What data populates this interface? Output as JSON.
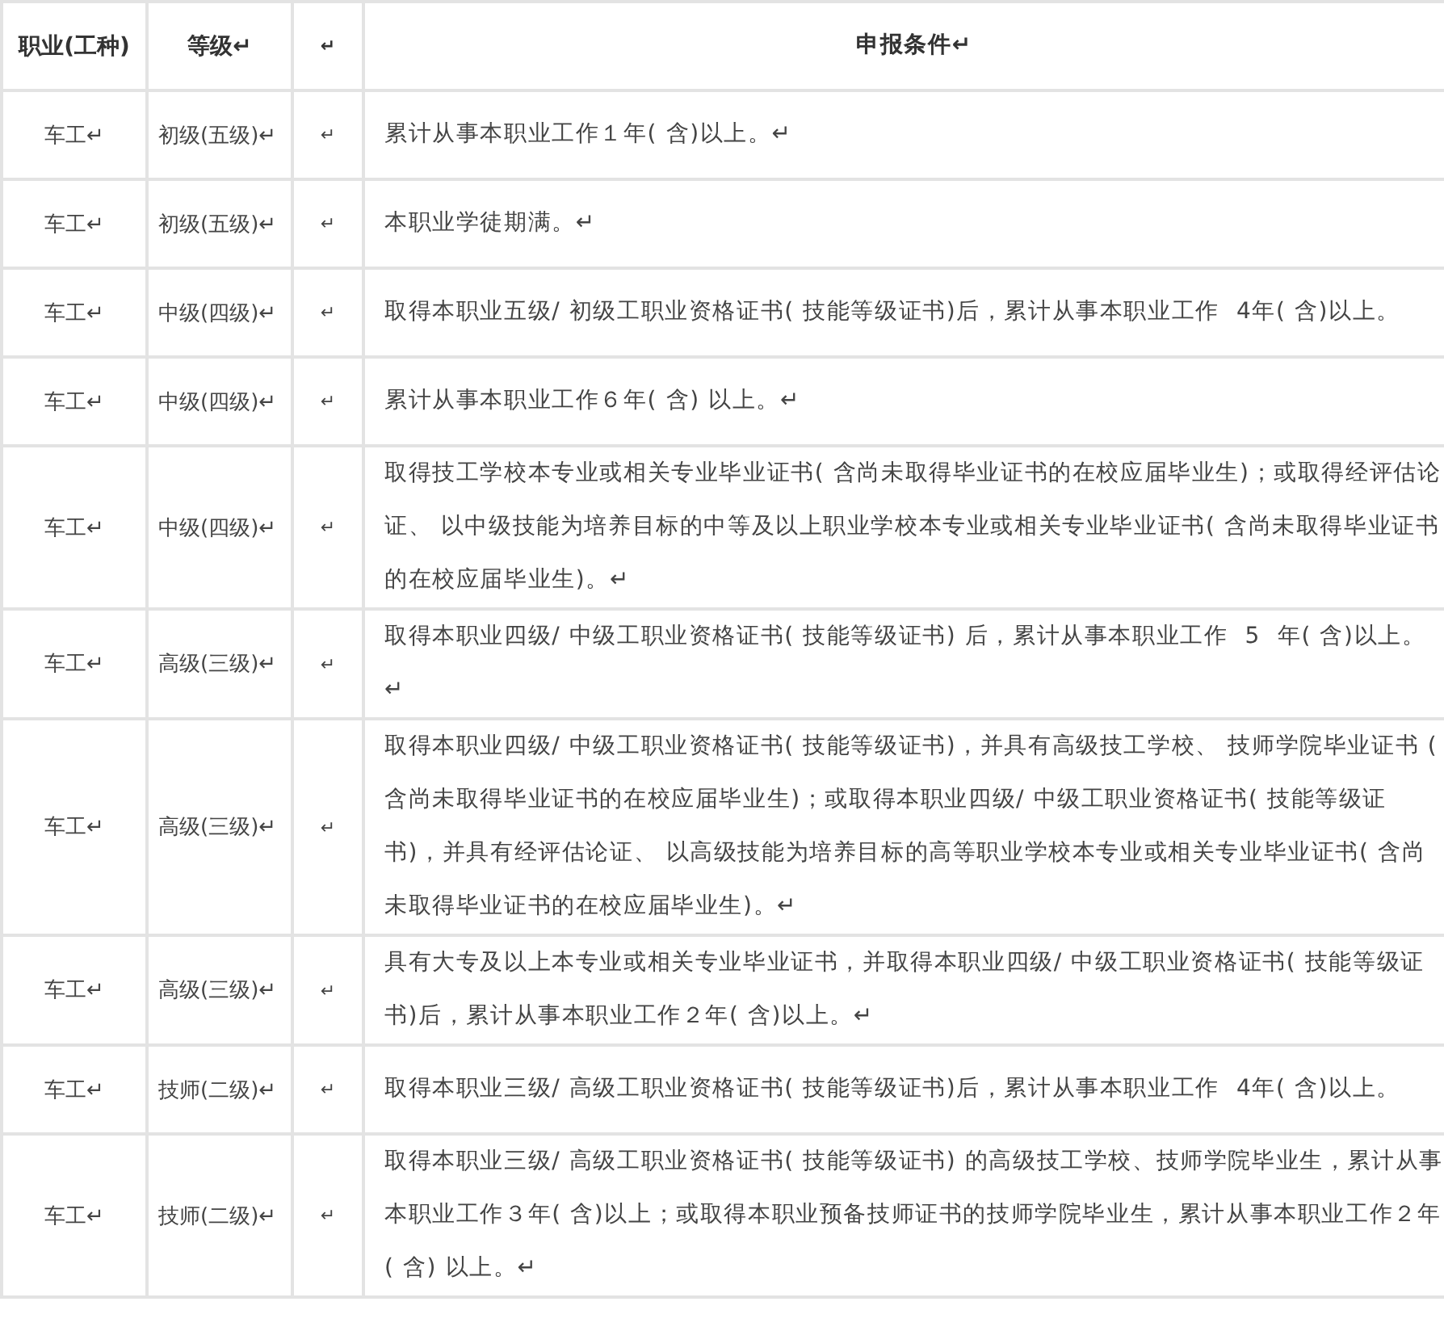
{
  "table": {
    "columns": [
      "职业(工种)",
      "等级↵",
      "↵",
      "申报条件↵"
    ],
    "rows": [
      [
        "车工↵",
        "初级(五级)↵",
        "↵",
        "累计从事本职业工作１年( 含)以上。↵"
      ],
      [
        "车工↵",
        "初级(五级)↵",
        "↵",
        "本职业学徒期满。↵"
      ],
      [
        "车工↵",
        "中级(四级)↵",
        "↵",
        "取得本职业五级/ 初级工职业资格证书( 技能等级证书)后，累计从事本职业工作  4年( 含)以上。"
      ],
      [
        "车工↵",
        "中级(四级)↵",
        "↵",
        "累计从事本职业工作６年( 含) 以上。↵"
      ],
      [
        "车工↵",
        "中级(四级)↵",
        "↵",
        "取得技工学校本专业或相关专业毕业证书( 含尚未取得毕业证书的在校应届毕业生)；或取得经评估论证、 以中级技能为培养目标的中等及以上职业学校本专业或相关专业毕业证书( 含尚未取得毕业证书的在校应届毕业生)。↵"
      ],
      [
        "车工↵",
        "高级(三级)↵",
        "↵",
        "取得本职业四级/ 中级工职业资格证书( 技能等级证书) 后，累计从事本职业工作  5  年( 含)以上。↵"
      ],
      [
        "车工↵",
        "高级(三级)↵",
        "↵",
        "取得本职业四级/ 中级工职业资格证书( 技能等级证书)，并具有高级技工学校、 技师学院毕业证书 ( 含尚未取得毕业证书的在校应届毕业生)；或取得本职业四级/ 中级工职业资格证书( 技能等级证书)，并具有经评估论证、 以高级技能为培养目标的高等职业学校本专业或相关专业毕业证书( 含尚未取得毕业证书的在校应届毕业生)。↵"
      ],
      [
        "车工↵",
        "高级(三级)↵",
        "↵",
        "具有大专及以上本专业或相关专业毕业证书，并取得本职业四级/ 中级工职业资格证书( 技能等级证书)后，累计从事本职业工作２年( 含)以上。↵"
      ],
      [
        "车工↵",
        "技师(二级)↵",
        "↵",
        "取得本职业三级/ 高级工职业资格证书( 技能等级证书)后，累计从事本职业工作  4年( 含)以上。"
      ],
      [
        "车工↵",
        "技师(二级)↵",
        "↵",
        "取得本职业三级/ 高级工职业资格证书( 技能等级证书) 的高级技工学校、技师学院毕业生，累计从事本职业工作３年( 含)以上；或取得本职业预备技师证书的技师学院毕业生，累计从事本职业工作２年( 含) 以上。↵"
      ]
    ]
  }
}
